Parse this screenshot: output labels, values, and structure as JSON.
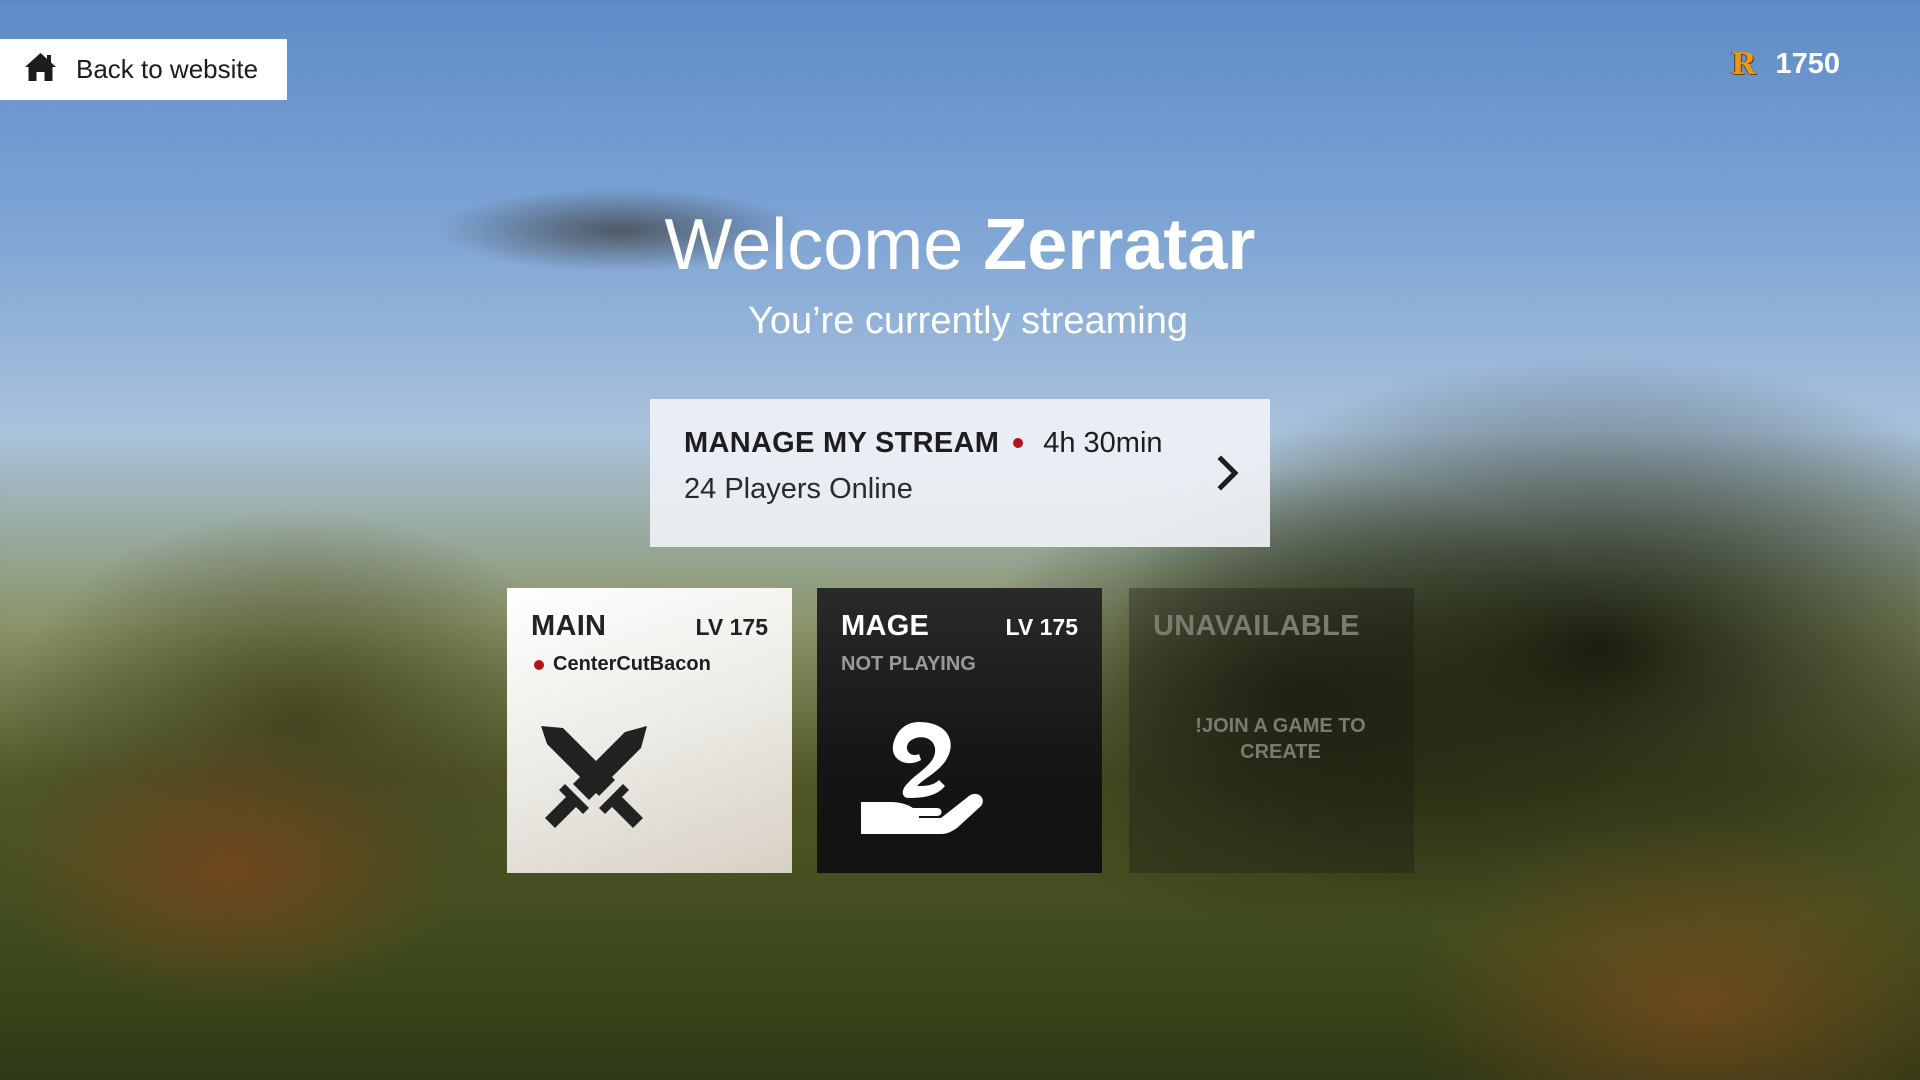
{
  "header": {
    "back_label": "Back to website",
    "back_icon": "home-icon",
    "currency_icon": "rune-coin-icon",
    "currency_amount": "1750"
  },
  "welcome": {
    "greeting": "Welcome ",
    "username": "Zerratar",
    "subtitle": "You’re currently streaming"
  },
  "stream": {
    "title": "MANAGE MY STREAM",
    "duration": "4h 30min",
    "players": "24 Players Online",
    "live_color": "#b3121f"
  },
  "characters": [
    {
      "name": "MAIN",
      "level": "LV 175",
      "status": "CenterCutBacon",
      "icon": "crossed-swords-icon"
    },
    {
      "name": "MAGE",
      "level": "LV 175",
      "status": "NOT PLAYING",
      "icon": "magic-hand-icon"
    },
    {
      "name": "UNAVAILABLE",
      "message": "!JOIN A GAME TO CREATE"
    }
  ]
}
